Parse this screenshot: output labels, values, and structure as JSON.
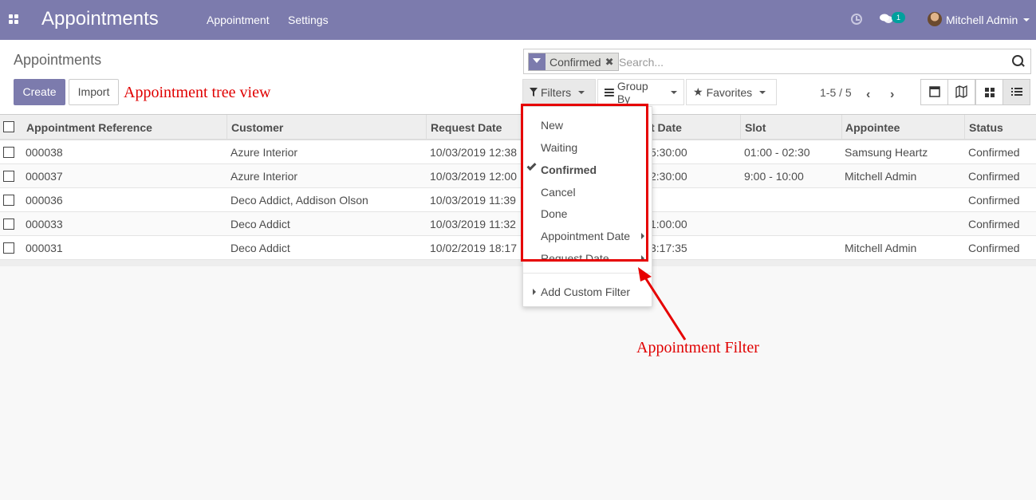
{
  "navbar": {
    "app_title": "Appointments",
    "menu": [
      "Appointment",
      "Settings"
    ],
    "chat_count": "1",
    "user_name": "Mitchell Admin"
  },
  "control_panel": {
    "breadcrumb": "Appointments",
    "create_label": "Create",
    "import_label": "Import",
    "annotation_tree": "Appointment tree view",
    "search": {
      "facet": "Confirmed",
      "placeholder": "Search..."
    },
    "filters_label": "Filters",
    "groupby_label": "Group By",
    "favorites_label": "Favorites",
    "pager": "1-5 / 5"
  },
  "table": {
    "headers": [
      "Appointment Reference",
      "Customer",
      "Request Date",
      "t Date",
      "Slot",
      "Appointee",
      "Status"
    ],
    "rows": [
      [
        "000038",
        "Azure Interior",
        "10/03/2019 12:38",
        "5:30:00",
        "01:00 - 02:30",
        "Samsung Heartz",
        "Confirmed"
      ],
      [
        "000037",
        "Azure Interior",
        "10/03/2019 12:00",
        "2:30:00",
        "9:00 - 10:00",
        "Mitchell Admin",
        "Confirmed"
      ],
      [
        "000036",
        "Deco Addict, Addison Olson",
        "10/03/2019 11:39",
        "",
        "",
        "",
        "Confirmed"
      ],
      [
        "000033",
        "Deco Addict",
        "10/03/2019 11:32",
        "1:00:00",
        "",
        "",
        "Confirmed"
      ],
      [
        "000031",
        "Deco Addict",
        "10/02/2019 18:17",
        "3:17:35",
        "",
        "Mitchell Admin",
        "Confirmed"
      ]
    ]
  },
  "filter_menu": {
    "items": [
      "New",
      "Waiting",
      "Confirmed",
      "Cancel",
      "Done",
      "Appointment Date",
      "Request Date"
    ],
    "add_custom": "Add Custom Filter"
  },
  "annotation_filter": "Appointment Filter",
  "colors": {
    "brand": "#7c7bad",
    "annotation": "#e00000",
    "badge": "#00a09d"
  }
}
